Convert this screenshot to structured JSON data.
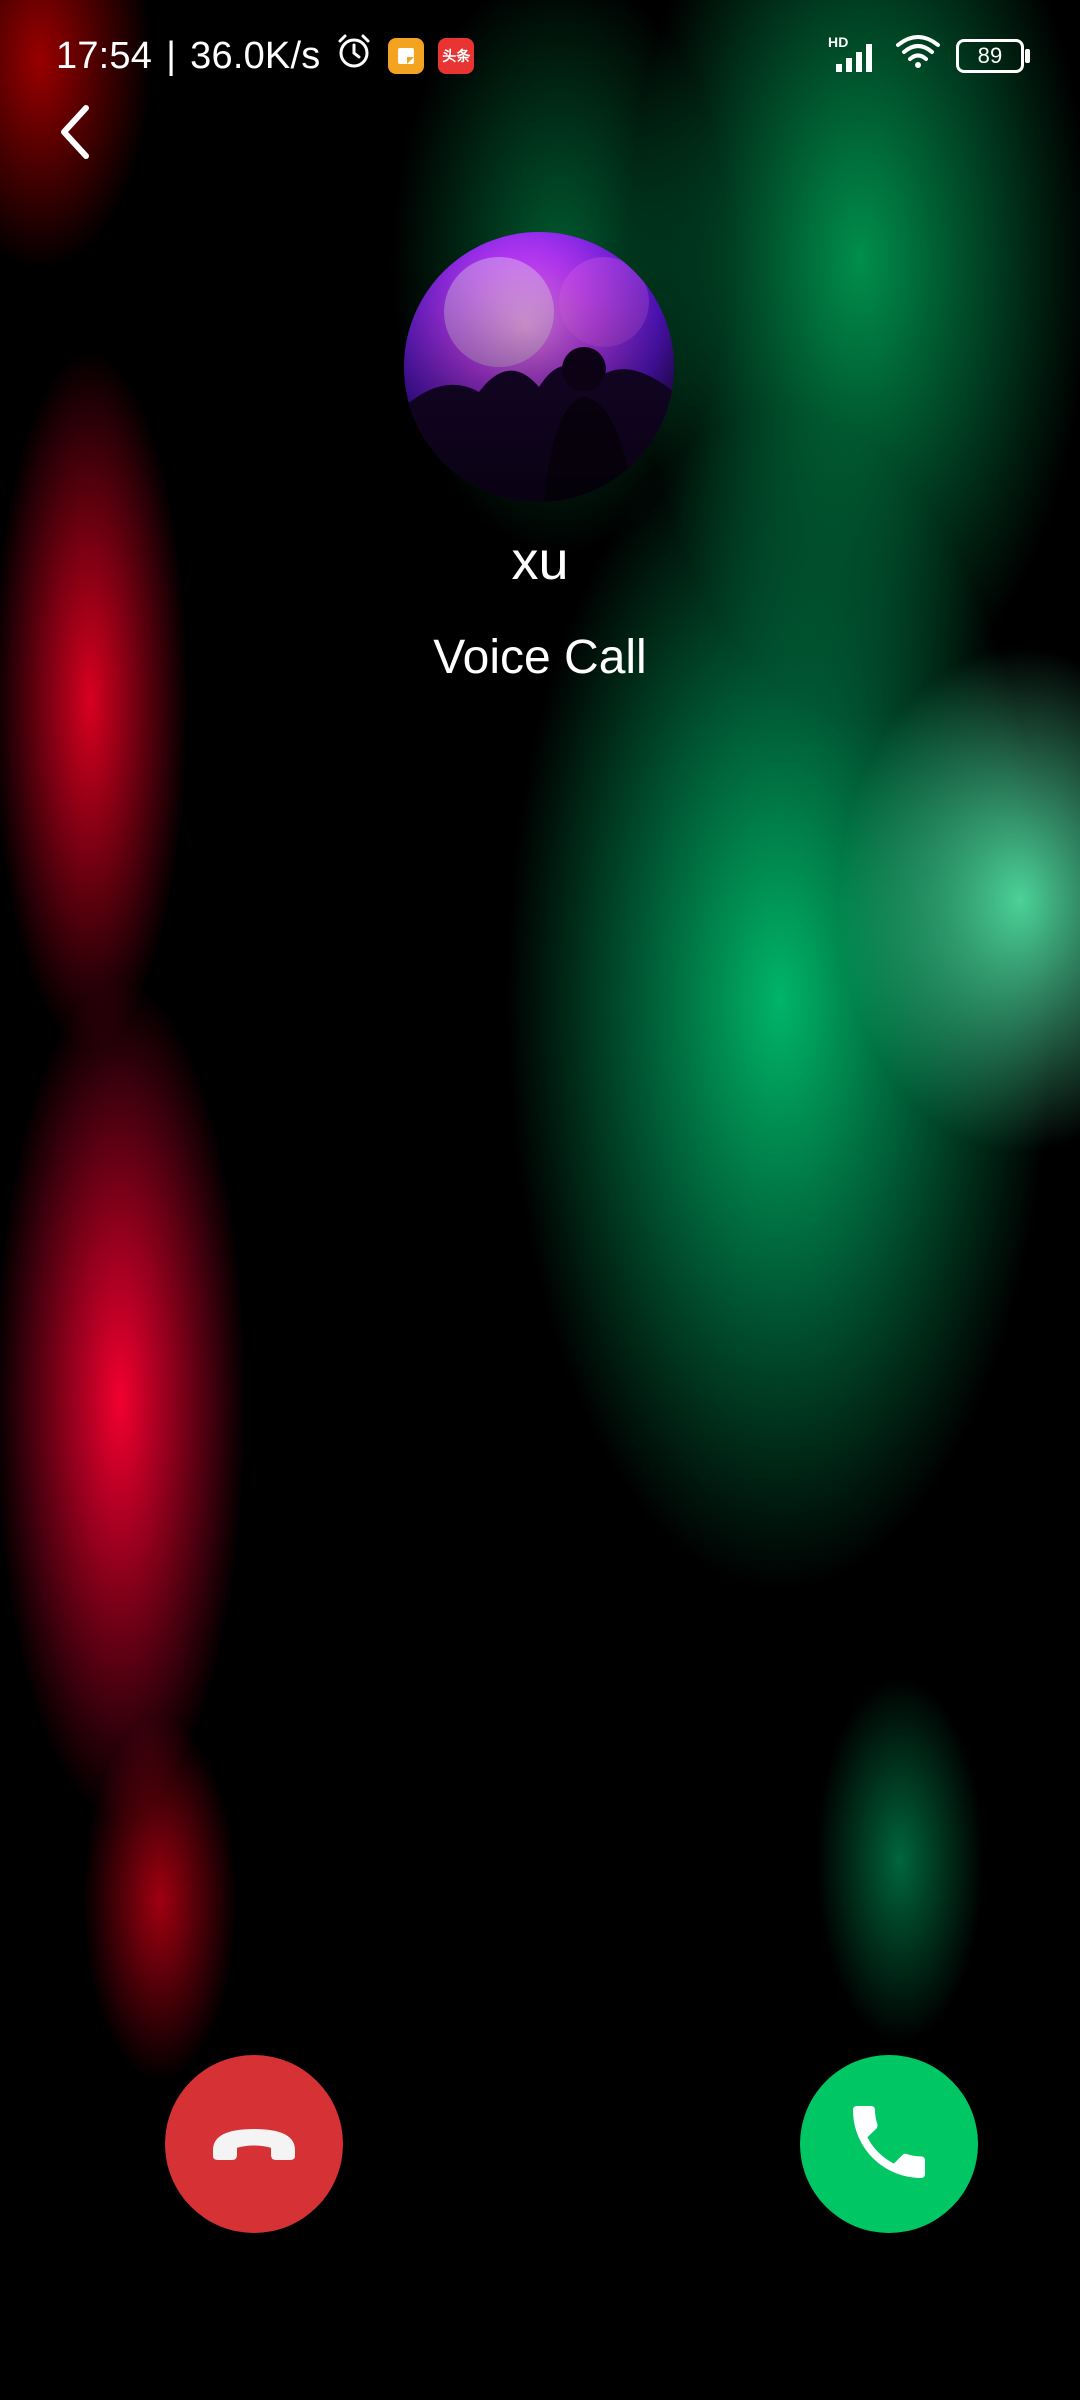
{
  "status_bar": {
    "time": "17:54",
    "separator": "|",
    "network_speed": "36.0K/s",
    "app_icon_1": "notes-app-icon",
    "app_icon_2_text": "头条",
    "signal_label": "HD",
    "battery_level": "89"
  },
  "call": {
    "caller_name": "xu",
    "call_type": "Voice Call"
  },
  "colors": {
    "decline": "#d63236",
    "accept": "#00c764"
  }
}
